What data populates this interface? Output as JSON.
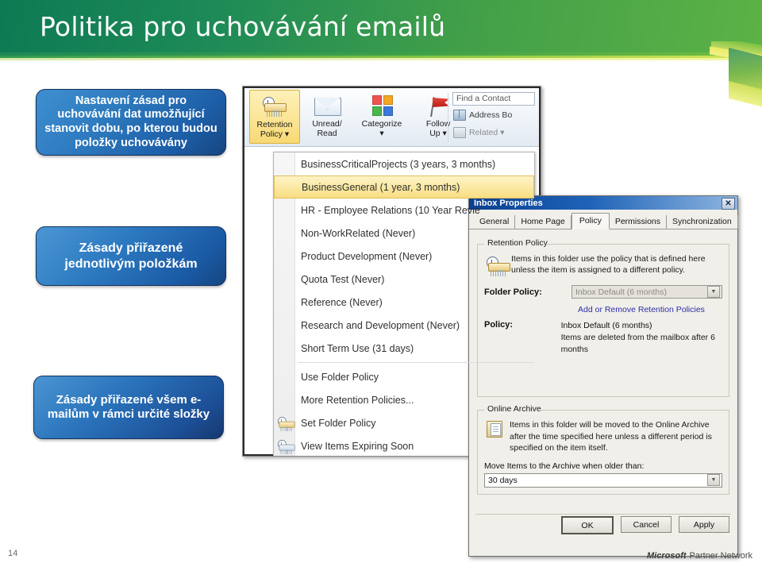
{
  "slide": {
    "title": "Politika pro uchovávání emailů",
    "page_number": "14"
  },
  "callouts": [
    {
      "text": "Nastavení zásad pro uchovávání dat umožňující stanovit dobu, po kterou budou položky uchovávány"
    },
    {
      "text": "Zásady přiřazené jednotlivým položkám"
    },
    {
      "text": "Zásady přiřazené všem e-mailům v rámci určité složky"
    }
  ],
  "outlook": {
    "ribbon": {
      "retention_policy": "Retention\nPolicy ▾",
      "unread_read": "Unread/\nRead",
      "categorize": "Categorize\n▾",
      "follow_up": "Follow\nUp ▾",
      "find_a_contact": "Find a Contact",
      "address_book": "Address Bo",
      "related": "Related ▾"
    },
    "menu": {
      "policies": [
        {
          "label": "BusinessCriticalProjects (3 years, 3 months)",
          "selected": false
        },
        {
          "label": "BusinessGeneral (1 year, 3 months)",
          "selected": true
        },
        {
          "label": "HR - Employee Relations (10 Year Revie",
          "selected": false
        },
        {
          "label": "Non-WorkRelated (Never)",
          "selected": false
        },
        {
          "label": "Product Development (Never)",
          "selected": false
        },
        {
          "label": "Quota Test (Never)",
          "selected": false
        },
        {
          "label": "Reference (Never)",
          "selected": false
        },
        {
          "label": "Research and Development (Never)",
          "selected": false
        },
        {
          "label": "Short Term Use (31 days)",
          "selected": false
        }
      ],
      "commands": [
        {
          "label": "Use Folder Policy",
          "icon": ""
        },
        {
          "label": "More Retention Policies...",
          "icon": ""
        },
        {
          "label": "Set Folder Policy",
          "icon": "retention-policy-icon"
        },
        {
          "label": "View Items Expiring Soon",
          "icon": "expiring-items-icon"
        }
      ]
    }
  },
  "dialog": {
    "title": "Inbox Properties",
    "close_label": "✕",
    "tabs": [
      {
        "label": "General",
        "active": false
      },
      {
        "label": "Home Page",
        "active": false
      },
      {
        "label": "Policy",
        "active": true
      },
      {
        "label": "Permissions",
        "active": false
      },
      {
        "label": "Synchronization",
        "active": false
      }
    ],
    "retention_group": {
      "title": "Retention Policy",
      "description": "Items in this folder use the policy that is defined here unless the item is assigned to a different policy.",
      "folder_policy_label": "Folder Policy:",
      "folder_policy_value": "Inbox Default (6 months)",
      "add_remove_link": "Add or Remove Retention Policies",
      "policy_label": "Policy:",
      "policy_value": "Inbox Default (6 months)",
      "policy_detail": "Items are deleted from the mailbox after 6 months"
    },
    "archive_group": {
      "title": "Online Archive",
      "description": "Items in this folder will be moved to the Online Archive after the time specified here unless a different period is specified on the item itself.",
      "move_label": "Move Items to the Archive when older than:",
      "move_value": "30 days"
    },
    "buttons": [
      {
        "label": "OK",
        "default": true
      },
      {
        "label": "Cancel",
        "default": false
      },
      {
        "label": "Apply",
        "default": false
      }
    ]
  },
  "footer": {
    "brand": "Microsoft",
    "brand_suffix": "Partner Network"
  },
  "colors": {
    "header_green_dark": "#0e7a54",
    "header_green_light": "#5cb246",
    "callout_blue": "#2d7ac0",
    "selection_gold": "#fbe9a4",
    "dialog_title_blue": "#0a3f8f",
    "link_blue": "#2b2fa8"
  }
}
